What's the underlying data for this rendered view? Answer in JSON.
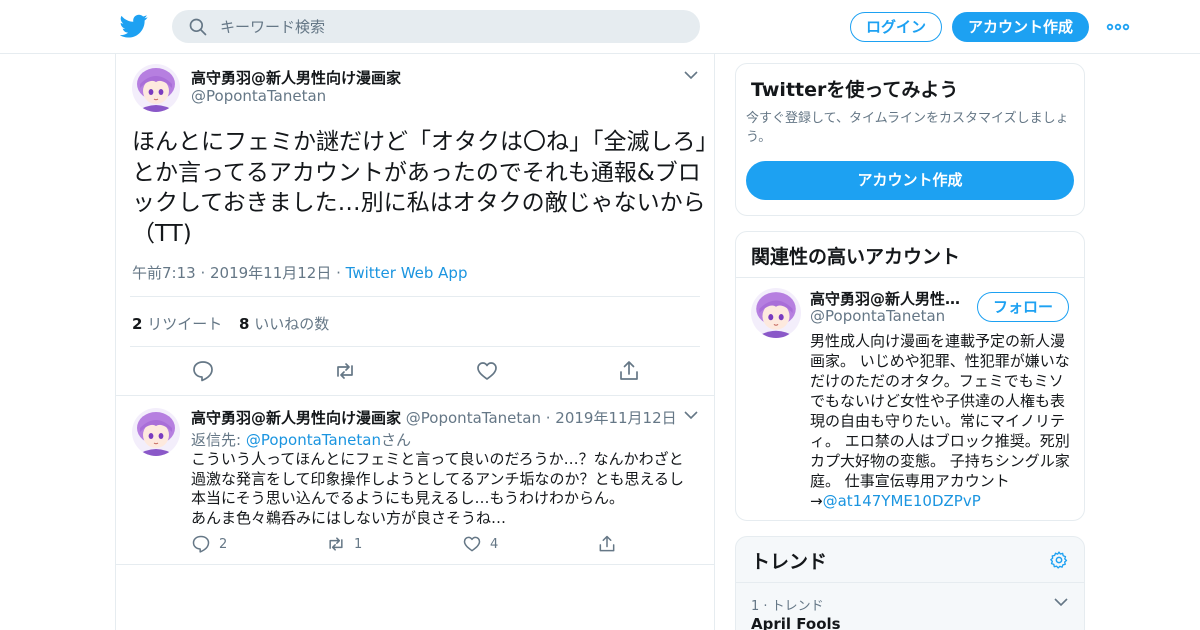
{
  "colors": {
    "accent": "#1da1f2",
    "link": "#1b95e0",
    "muted": "#657786",
    "border": "#e6ecf0",
    "text": "#14171a"
  },
  "header": {
    "logo_icon": "twitter-bird-icon",
    "search_placeholder": "キーワード検索",
    "login_label": "ログイン",
    "signup_label": "アカウント作成",
    "more_icon": "more-icon"
  },
  "tweet": {
    "name": "高守勇羽@新人男性向け漫画家",
    "handle": "@PopontaTanetan",
    "text": "ほんとにフェミか謎だけど「オタクは〇ね」「全滅しろ」とか言ってるアカウントがあったのでそれも通報&ブロックしておきました…別に私はオタクの敵じゃないから（TT)",
    "time": "午前7:13 · 2019年11月12日",
    "dot": " · ",
    "via": "Twitter Web App",
    "retweet_count": "2",
    "retweet_label": "リツイート",
    "like_count": "8",
    "like_label": "いいねの数"
  },
  "reply": {
    "name": "高守勇羽@新人男性向け漫画家",
    "handle": "@PopontaTanetan",
    "date": "· 2019年11月12日",
    "replyto_prefix": "返信先: ",
    "replyto_handle": "@PopontaTanetan",
    "replyto_suffix": "さん",
    "text": "こういう人ってほんとにフェミと言って良いのだろうか…？なんかわざと\n過激な発言をして印象操作しようとしてるアンチ垢なのか？とも思えるし\n本当にそう思い込んでるようにも見えるし…もうわけわからん。\nあんま色々鵜呑みにはしない方が良さそうね…",
    "reply_count": "2",
    "retweet_count": "1",
    "like_count": "4"
  },
  "sidebar": {
    "signup_card": {
      "title": "Twitterを使ってみよう",
      "description": "今すぐ登録して、タイムラインをカスタマイズしましょう。",
      "button": "アカウント作成"
    },
    "related_card": {
      "title": "関連性の高いアカウント",
      "name": "高守勇羽@新人男性…",
      "handle": "@PopontaTanetan",
      "follow_label": "フォロー",
      "bio": "男性成人向け漫画を連載予定の新人漫画家。 いじめや犯罪、性犯罪が嫌いなだけのただのオタク。フェミでもミソでもないけど女性や子供達の人権も表現の自由も守りたい。常にマイノリティ。 エロ禁の人はブロック推奨。死別カプ大好物の変態。 子持ちシングル家庭。 仕事宣伝専用アカウント→",
      "bio_link": "@at147YME10DZPvP"
    },
    "trends_card": {
      "title": "トレンド",
      "rank": "1 · トレンド",
      "topic": "April Fools"
    }
  }
}
